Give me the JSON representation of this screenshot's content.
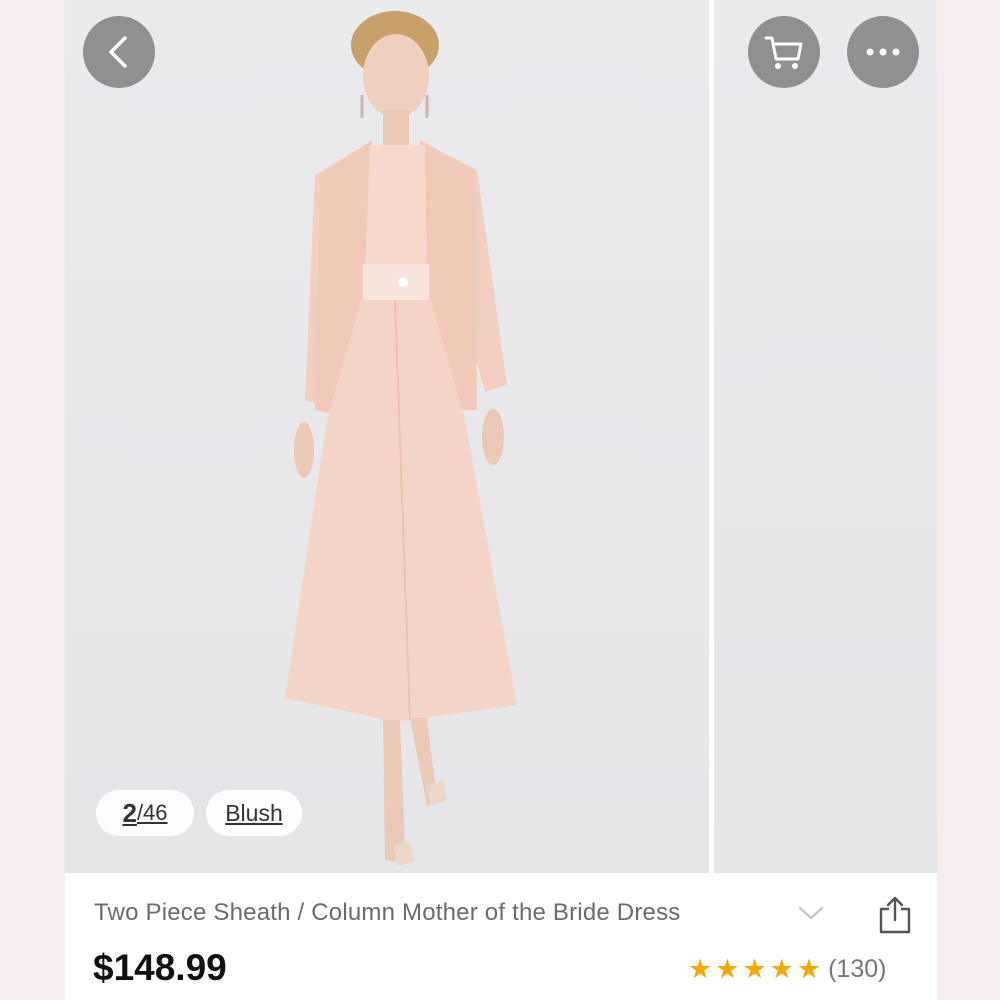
{
  "gallery": {
    "current_index": "2",
    "total_separator": "/46",
    "color_label": "Blush"
  },
  "product": {
    "title": "Two Piece Sheath / Column Mother of the Bride Dress",
    "price": "$148.99",
    "rating_stars": 5,
    "review_count": "(130)"
  },
  "icons": {
    "back": "back-chevron-icon",
    "cart": "shopping-cart-icon",
    "more": "more-dots-icon",
    "expand": "chevron-down-icon",
    "share": "share-icon",
    "star": "star-icon"
  },
  "colors": {
    "dress": "#f4d6c8",
    "star": "#f5a800",
    "button_overlay": "#808080"
  }
}
